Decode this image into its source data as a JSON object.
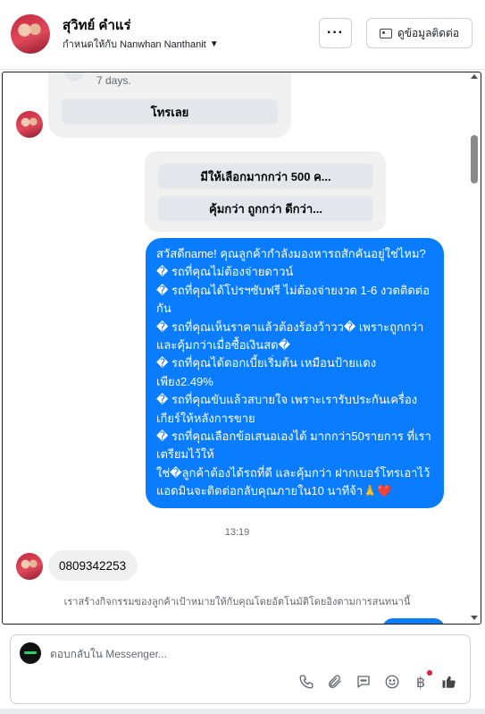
{
  "header": {
    "contact_name": "สุวิทย์ คำแร่",
    "assigned_label": "กำหนดให้กับ Nanwhan Nanthanit",
    "more_button": "···",
    "info_button": "ดูข้อมูลติดต่อ"
  },
  "conversation": {
    "top_card": {
      "muted_text": "7 days.",
      "call_button": "โทรเลย"
    },
    "quick_replies": [
      "มีให้เลือกมากกว่า 500 ค...",
      "คุ้มกว่า ถูกกว่า ดีกว่า..."
    ],
    "sent_message": "สวัสดีname! คุณลูกค้ากำลังมองหารถสักคันอยู่ใช่ไหม?\n� รถที่คุณไม่ต้องจ่ายดาวน์\n� รถที่คุณได้โปรฯซับฟรี ไม่ต้องจ่ายงวด 1-6 งวดติดต่อกัน\n� รถที่คุณเห็นราคาแล้วต้องร้องว้าวว� เพราะถูกกว่าและคุ้มกว่าเมื่อซื้อเงินสด�\n� รถที่คุณได้ดอกเบี้ยเริ่มต้น เหมือนป้ายแดง เพียง2.49%\n� รถที่คุณขับแล้วสบายใจ เพราะเรารับประกันเครื่องเกียร์ให้หลังการขาย\n� รถที่คุณเลือกข้อเสนอเองได้ มากกว่า50รายการ ที่เราเตรียมไว้ให้\nใช่�ลูกค้าต้องได้รถที่ดี และคุ้มกว่า ฝากเบอร์โทรเอาไว้ แอดมินจะติดต่อกลับคุณภายใน10 นาทีจ้า🙏❤️",
    "timestamp": "13:19",
    "received_phone": "0809342253",
    "notice": "เราสร้างกิจกรรมของลูกค้าเป้าหมายให้กับคุณโดยอัตโนมัติโดยอิงตามการสนทนานี้"
  },
  "composer": {
    "placeholder": "ตอบกลับใน Messenger..."
  },
  "icons": [
    "phone-icon",
    "paperclip-icon",
    "saved-replies-icon",
    "emoji-icon",
    "baht-icon",
    "like-icon"
  ],
  "colors": {
    "sent_bubble": "#0a7cff",
    "received_bubble": "#f0f0f0",
    "notification_dot": "#e41e3f"
  }
}
